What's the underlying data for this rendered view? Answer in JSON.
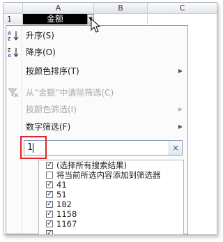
{
  "sheet": {
    "columns": [
      "A",
      "B",
      "C"
    ],
    "row_number": "1",
    "cell_a1_value": "金额",
    "dropdown_glyph": "▼"
  },
  "menu": {
    "items": [
      {
        "label": "升序(S)",
        "icon": "sort-ascending-icon",
        "enabled": true,
        "submenu": false
      },
      {
        "label": "降序(O)",
        "icon": "sort-descending-icon",
        "enabled": true,
        "submenu": false
      },
      {
        "label": "按颜色排序(T)",
        "icon": "",
        "enabled": true,
        "submenu": true
      },
      {
        "label": "从“金额”中清除筛选(C)",
        "icon": "clear-filter-icon",
        "enabled": false,
        "submenu": false
      },
      {
        "label": "按颜色筛选(I)",
        "icon": "",
        "enabled": false,
        "submenu": true
      },
      {
        "label": "数字筛选(F)",
        "icon": "",
        "enabled": true,
        "submenu": true
      }
    ],
    "submenu_arrow": "▶"
  },
  "search": {
    "value": "1",
    "clear_glyph": "×"
  },
  "filter_list": {
    "check_glyph": "✓",
    "items": [
      {
        "label": "(选择所有搜索结果)",
        "checked": true
      },
      {
        "label": "将当前所选内容添加到筛选器",
        "checked": false
      },
      {
        "label": "41",
        "checked": true
      },
      {
        "label": "51",
        "checked": true
      },
      {
        "label": "182",
        "checked": true
      },
      {
        "label": "1158",
        "checked": true
      },
      {
        "label": "1167",
        "checked": true
      },
      {
        "label": "",
        "checked": true
      }
    ]
  },
  "colors": {
    "highlight_box": "#e0262a",
    "disabled_text": "#a7a7a7",
    "header_cell_bg": "#000000"
  }
}
